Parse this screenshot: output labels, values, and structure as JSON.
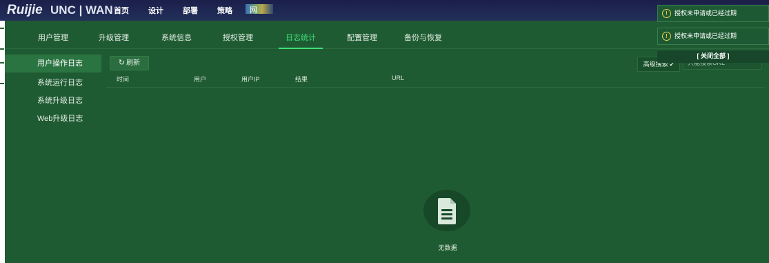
{
  "header": {
    "logo_text": "Ruijie",
    "logo_sub": "UNC | WAN",
    "nav": [
      "首页",
      "设计",
      "部署",
      "策略"
    ],
    "nav_glitch_text": "网"
  },
  "tabs": [
    {
      "label": "用户管理",
      "active": false
    },
    {
      "label": "升级管理",
      "active": false
    },
    {
      "label": "系统信息",
      "active": false
    },
    {
      "label": "授权管理",
      "active": false
    },
    {
      "label": "日志统计",
      "active": true
    },
    {
      "label": "配置管理",
      "active": false
    },
    {
      "label": "备份与恢复",
      "active": false
    }
  ],
  "sidebar": {
    "items": [
      {
        "label": "用户操作日志",
        "active": true
      },
      {
        "label": "系统运行日志",
        "active": false
      },
      {
        "label": "系统升级日志",
        "active": false
      },
      {
        "label": "Web升级日志",
        "active": false
      }
    ]
  },
  "toolbar": {
    "refresh_label": "刷新",
    "refresh_icon": "refresh-icon"
  },
  "table": {
    "columns": [
      "时间",
      "用户",
      "用户IP",
      "结果",
      "URL"
    ]
  },
  "search": {
    "advanced_label": "高级搜索",
    "placeholder": "只能搜索URL"
  },
  "empty_state": {
    "text": "无数据",
    "icon": "document-icon"
  },
  "notifications": [
    {
      "text": "授权未申请或已经过期",
      "icon": "warning-icon"
    },
    {
      "text": "授权未申请或已经过期",
      "icon": "warning-icon"
    }
  ],
  "close_all_label": "[ 关闭全部 ]",
  "colors": {
    "panel": "#1f5b32",
    "accent": "#3ee07a",
    "topbar": "#1b1f4a",
    "warning": "#f1d24b"
  }
}
